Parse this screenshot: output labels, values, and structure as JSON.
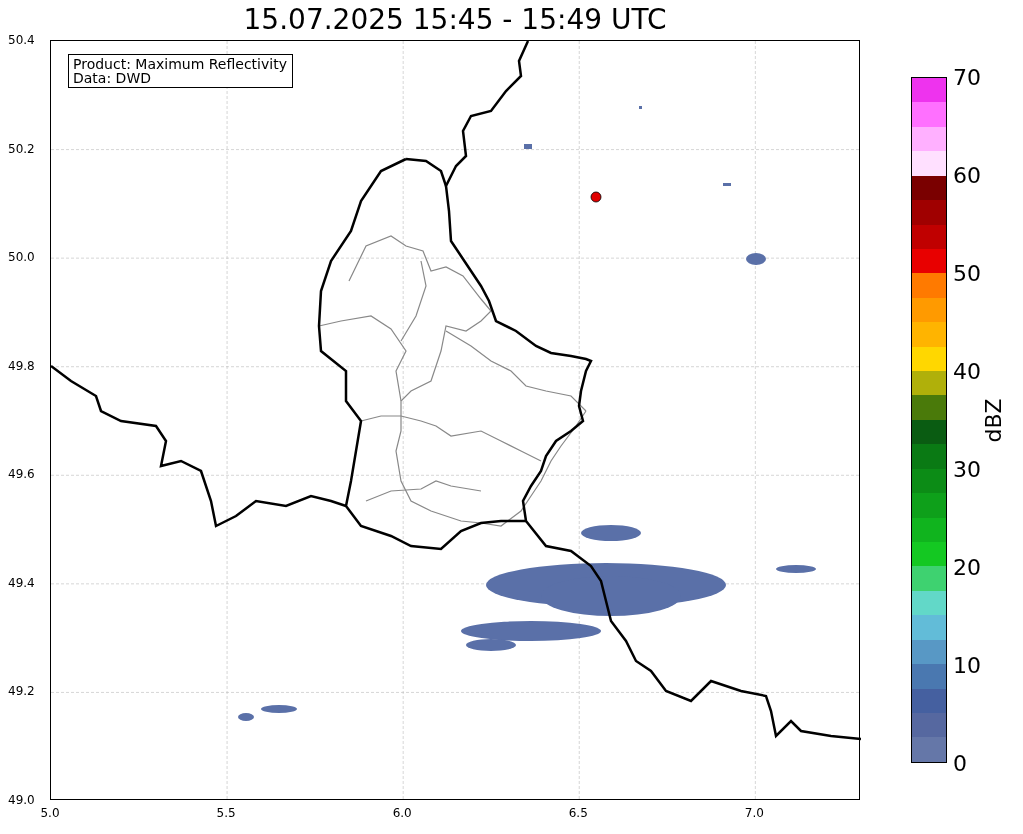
{
  "title": "15.07.2025 15:45 - 15:49 UTC",
  "info_box": {
    "lines": [
      "Product: Maximum Reflectivity",
      "Data: DWD"
    ]
  },
  "map": {
    "x_ticks": [
      "5.0",
      "5.5",
      "6.0",
      "6.5",
      "7.0"
    ],
    "y_ticks": [
      "50.4",
      "50.2",
      "50.0",
      "49.8",
      "49.6",
      "49.4",
      "49.2",
      "49.0"
    ]
  },
  "colorbar": {
    "label": "dBZ",
    "ticks": [
      "70",
      "60",
      "50",
      "40",
      "30",
      "20",
      "10",
      "0"
    ],
    "segments": [
      {
        "color": "#ee33ee"
      },
      {
        "color": "#ff70ff"
      },
      {
        "color": "#ffb0ff"
      },
      {
        "color": "#ffe0ff"
      },
      {
        "color": "#7a0000"
      },
      {
        "color": "#a00000"
      },
      {
        "color": "#c00000"
      },
      {
        "color": "#e80000"
      },
      {
        "color": "#ff7a00"
      },
      {
        "color": "#ff9a00"
      },
      {
        "color": "#ffb400"
      },
      {
        "color": "#ffd700"
      },
      {
        "color": "#b0b00a"
      },
      {
        "color": "#4a7a0a"
      },
      {
        "color": "#0a5c12"
      },
      {
        "color": "#0a7a14"
      },
      {
        "color": "#0c8c16"
      },
      {
        "color": "#0ea01a"
      },
      {
        "color": "#10b41e"
      },
      {
        "color": "#14c822"
      },
      {
        "color": "#3ed270"
      },
      {
        "color": "#62d8c8"
      },
      {
        "color": "#62bcd8"
      },
      {
        "color": "#5898c5"
      },
      {
        "color": "#4a78b0"
      },
      {
        "color": "#4560a0"
      },
      {
        "color": "#5668a0"
      },
      {
        "color": "#6577a8"
      }
    ]
  }
}
